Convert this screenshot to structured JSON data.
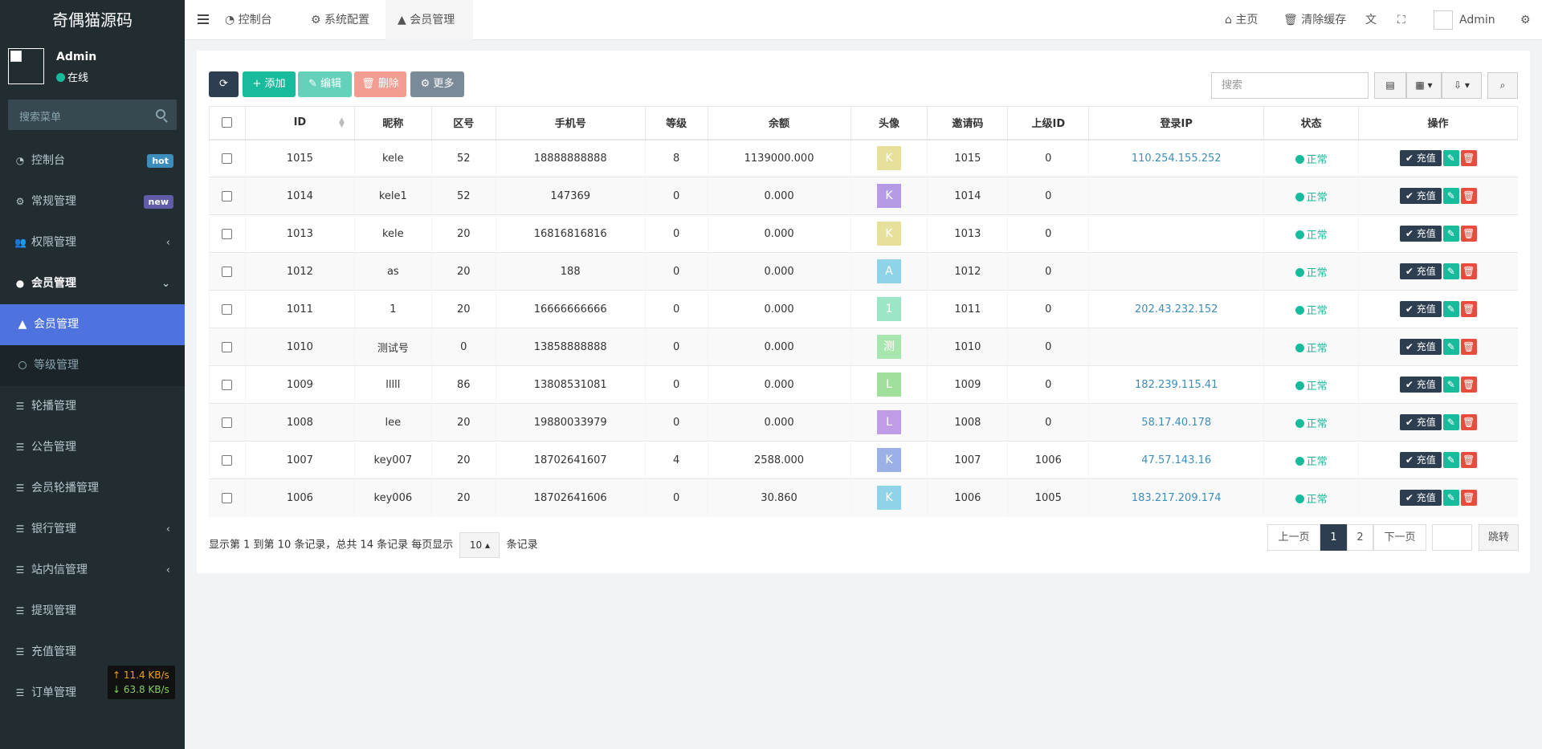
{
  "sidebar": {
    "logo": "奇偶猫源码",
    "user_name": "Admin",
    "user_status": "在线",
    "search_placeholder": "搜索菜单",
    "menu": [
      {
        "label": "控制台",
        "badge": "hot"
      },
      {
        "label": "常规管理",
        "badge": "new"
      },
      {
        "label": "权限管理"
      },
      {
        "label": "会员管理"
      }
    ],
    "submenu": [
      {
        "label": "会员管理"
      },
      {
        "label": "等级管理"
      }
    ],
    "menu2": [
      {
        "label": "轮播管理"
      },
      {
        "label": "公告管理"
      },
      {
        "label": "会员轮播管理"
      },
      {
        "label": "银行管理"
      },
      {
        "label": "站内信管理"
      },
      {
        "label": "提现管理"
      },
      {
        "label": "充值管理"
      },
      {
        "label": "订单管理"
      }
    ],
    "net_up": "↑ 11.4 KB/s",
    "net_down": "↓ 63.8 KB/s"
  },
  "topbar": {
    "tabs": [
      "控制台",
      "系统配置",
      "会员管理"
    ],
    "home": "主页",
    "clear_cache": "清除缓存",
    "admin": "Admin"
  },
  "toolbar": {
    "add": "添加",
    "edit": "编辑",
    "delete": "删除",
    "more": "更多",
    "search_placeholder": "搜索"
  },
  "table": {
    "headers": [
      "ID",
      "昵称",
      "区号",
      "手机号",
      "等级",
      "余额",
      "头像",
      "邀请码",
      "上级ID",
      "登录IP",
      "状态",
      "操作"
    ],
    "charge_label": "充值",
    "rows": [
      {
        "id": "1015",
        "nick": "kele",
        "area": "52",
        "phone": "18888888888",
        "level": "8",
        "balance": "1139000.000",
        "avatar": "K",
        "avatar_color": "#e6e09a",
        "invite": "1015",
        "parent": "0",
        "ip": "110.254.155.252",
        "status": "正常"
      },
      {
        "id": "1014",
        "nick": "kele1",
        "area": "52",
        "phone": "147369",
        "level": "0",
        "balance": "0.000",
        "avatar": "K",
        "avatar_color": "#b59be6",
        "invite": "1014",
        "parent": "0",
        "ip": "",
        "status": "正常"
      },
      {
        "id": "1013",
        "nick": "kele",
        "area": "20",
        "phone": "16816816816",
        "level": "0",
        "balance": "0.000",
        "avatar": "K",
        "avatar_color": "#e6e09a",
        "invite": "1013",
        "parent": "0",
        "ip": "",
        "status": "正常"
      },
      {
        "id": "1012",
        "nick": "as",
        "area": "20",
        "phone": "188",
        "level": "0",
        "balance": "0.000",
        "avatar": "A",
        "avatar_color": "#8fd3e8",
        "invite": "1012",
        "parent": "0",
        "ip": "",
        "status": "正常"
      },
      {
        "id": "1011",
        "nick": "1",
        "area": "20",
        "phone": "16666666666",
        "level": "0",
        "balance": "0.000",
        "avatar": "1",
        "avatar_color": "#9ce6c8",
        "invite": "1011",
        "parent": "0",
        "ip": "202.43.232.152",
        "status": "正常"
      },
      {
        "id": "1010",
        "nick": "测试号",
        "area": "0",
        "phone": "13858888888",
        "level": "0",
        "balance": "0.000",
        "avatar": "测",
        "avatar_color": "#a8e6b0",
        "invite": "1010",
        "parent": "0",
        "ip": "",
        "status": "正常"
      },
      {
        "id": "1009",
        "nick": "lllll",
        "area": "86",
        "phone": "13808531081",
        "level": "0",
        "balance": "0.000",
        "avatar": "L",
        "avatar_color": "#a0e09a",
        "invite": "1009",
        "parent": "0",
        "ip": "182.239.115.41",
        "status": "正常"
      },
      {
        "id": "1008",
        "nick": "lee",
        "area": "20",
        "phone": "19880033979",
        "level": "0",
        "balance": "0.000",
        "avatar": "L",
        "avatar_color": "#c09be6",
        "invite": "1008",
        "parent": "0",
        "ip": "58.17.40.178",
        "status": "正常"
      },
      {
        "id": "1007",
        "nick": "key007",
        "area": "20",
        "phone": "18702641607",
        "level": "4",
        "balance": "2588.000",
        "avatar": "K",
        "avatar_color": "#9ab0e6",
        "invite": "1007",
        "parent": "1006",
        "ip": "47.57.143.16",
        "status": "正常"
      },
      {
        "id": "1006",
        "nick": "key006",
        "area": "20",
        "phone": "18702641606",
        "level": "0",
        "balance": "30.860",
        "avatar": "K",
        "avatar_color": "#8fd3e8",
        "invite": "1006",
        "parent": "1005",
        "ip": "183.217.209.174",
        "status": "正常"
      }
    ]
  },
  "footer": {
    "summary": "显示第 1 到第 10 条记录，总共 14 条记录 每页显示",
    "page_size": "10",
    "per_page_suffix": "条记录",
    "prev": "上一页",
    "page1": "1",
    "page2": "2",
    "next": "下一页",
    "jump": "跳转"
  }
}
